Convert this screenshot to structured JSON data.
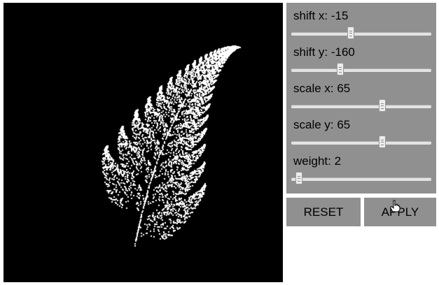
{
  "fractal": {
    "colors": {
      "background": "#000000",
      "points": "#ffffff"
    }
  },
  "controls": [
    {
      "label": "shift x: -15",
      "value": -15,
      "min": -100,
      "max": 100
    },
    {
      "label": "shift y: -160",
      "value": -160,
      "min": -300,
      "max": 100
    },
    {
      "label": "scale x: 65",
      "value": 65,
      "min": 0,
      "max": 100
    },
    {
      "label": "scale y: 65",
      "value": 65,
      "min": 0,
      "max": 100
    },
    {
      "label": "weight: 2",
      "value": 2,
      "min": 1,
      "max": 20
    }
  ],
  "buttons": {
    "reset": "RESET",
    "apply": "APPLY"
  },
  "colors": {
    "panel": "#909090",
    "page": "#ffffff"
  }
}
